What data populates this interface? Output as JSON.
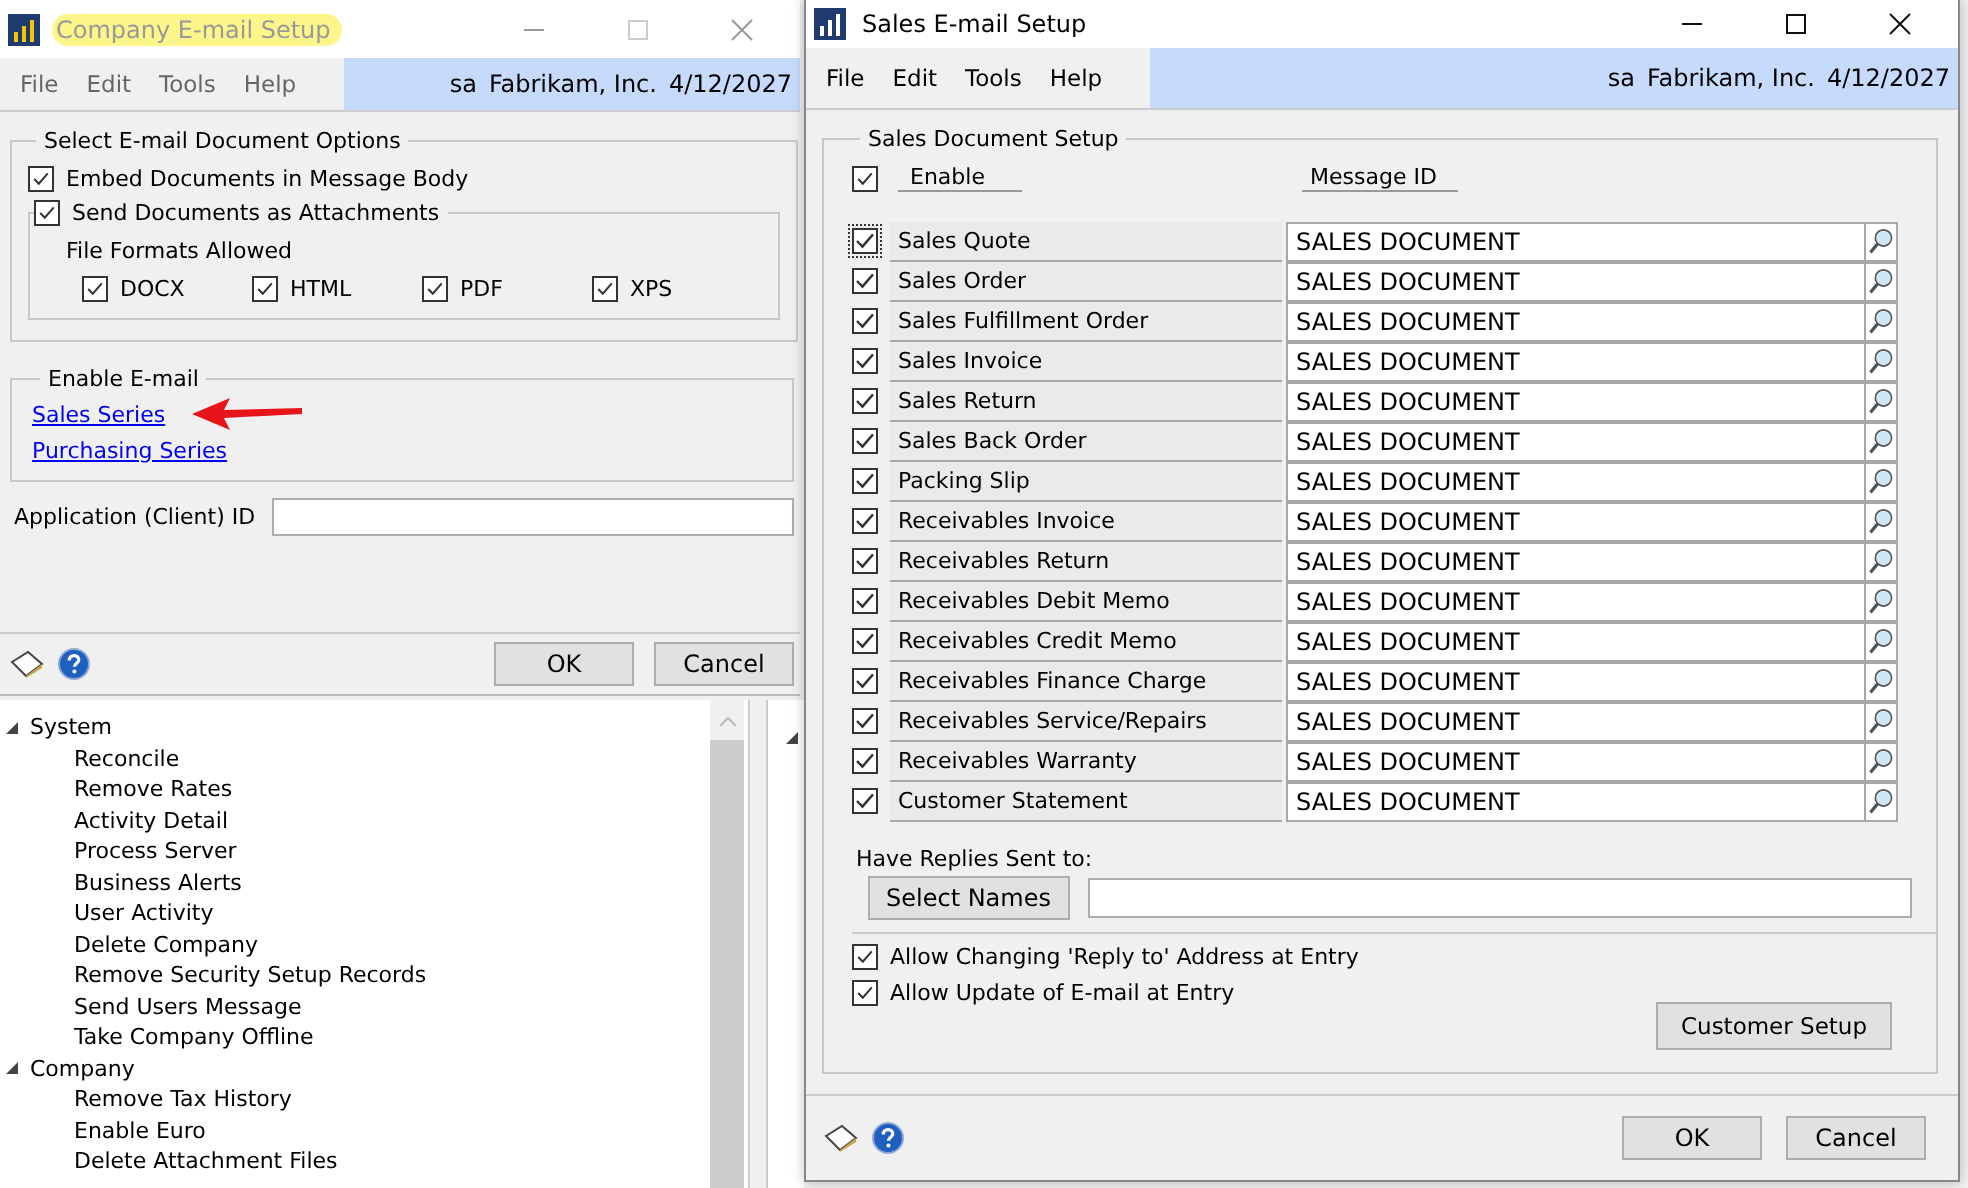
{
  "company_window": {
    "title": "Company E-mail Setup",
    "title_highlighted": true,
    "active": false,
    "menu": [
      "File",
      "Edit",
      "Tools",
      "Help"
    ],
    "status": {
      "user": "sa",
      "company": "Fabrikam, Inc.",
      "date": "4/12/2027"
    },
    "document_options": {
      "legend": "Select E-mail Document Options",
      "embed": {
        "label": "Embed Documents in Message Body",
        "checked": true
      },
      "attach": {
        "label": "Send Documents as Attachments",
        "checked": true
      },
      "formats_label": "File Formats Allowed",
      "formats": [
        {
          "label": "DOCX",
          "checked": true
        },
        {
          "label": "HTML",
          "checked": true
        },
        {
          "label": "PDF",
          "checked": true
        },
        {
          "label": "XPS",
          "checked": true
        }
      ]
    },
    "enable_email": {
      "legend": "Enable E-mail",
      "links": [
        "Sales Series",
        "Purchasing Series"
      ]
    },
    "client_id": {
      "label": "Application (Client) ID"
    },
    "buttons": [
      "OK",
      "Cancel"
    ]
  },
  "navigation_tree": [
    {
      "label": "System",
      "expanded": true,
      "children": [
        {
          "label": "Reconcile"
        },
        {
          "label": "Remove Rates"
        },
        {
          "label": "Activity Detail"
        },
        {
          "label": "Process Server"
        },
        {
          "label": "Business Alerts"
        },
        {
          "label": "User Activity"
        },
        {
          "label": "Delete Company"
        },
        {
          "label": "Remove Security Setup Records"
        },
        {
          "label": "Send Users Message"
        },
        {
          "label": "Take Company Offline"
        }
      ]
    },
    {
      "label": "Company",
      "expanded": true,
      "children": [
        {
          "label": "Remove Tax History"
        },
        {
          "label": "Enable Euro"
        },
        {
          "label": "Delete Attachment Files"
        }
      ]
    }
  ],
  "sales_window": {
    "title": "Sales E-mail Setup",
    "active": true,
    "menu": [
      "File",
      "Edit",
      "Tools",
      "Help"
    ],
    "status": {
      "user": "sa",
      "company": "Fabrikam, Inc.",
      "date": "4/12/2027"
    },
    "legend": "Sales Document Setup",
    "enable_all": {
      "label": "Enable",
      "checked": true
    },
    "message_id_header": "Message ID",
    "rows": [
      {
        "label": "Sales Quote",
        "checked": true,
        "focused": true,
        "message_id": "SALES DOCUMENT"
      },
      {
        "label": "Sales Order",
        "checked": true,
        "focused": false,
        "message_id": "SALES DOCUMENT"
      },
      {
        "label": "Sales Fulfillment Order",
        "checked": true,
        "focused": false,
        "message_id": "SALES DOCUMENT"
      },
      {
        "label": "Sales Invoice",
        "checked": true,
        "focused": false,
        "message_id": "SALES DOCUMENT"
      },
      {
        "label": "Sales Return",
        "checked": true,
        "focused": false,
        "message_id": "SALES DOCUMENT"
      },
      {
        "label": "Sales Back Order",
        "checked": true,
        "focused": false,
        "message_id": "SALES DOCUMENT"
      },
      {
        "label": "Packing Slip",
        "checked": true,
        "focused": false,
        "message_id": "SALES DOCUMENT"
      },
      {
        "label": "Receivables Invoice",
        "checked": true,
        "focused": false,
        "message_id": "SALES DOCUMENT"
      },
      {
        "label": "Receivables Return",
        "checked": true,
        "focused": false,
        "message_id": "SALES DOCUMENT"
      },
      {
        "label": "Receivables Debit Memo",
        "checked": true,
        "focused": false,
        "message_id": "SALES DOCUMENT"
      },
      {
        "label": "Receivables Credit Memo",
        "checked": true,
        "focused": false,
        "message_id": "SALES DOCUMENT"
      },
      {
        "label": "Receivables Finance Charge",
        "checked": true,
        "focused": false,
        "message_id": "SALES DOCUMENT"
      },
      {
        "label": "Receivables Service/Repairs",
        "checked": true,
        "focused": false,
        "message_id": "SALES DOCUMENT"
      },
      {
        "label": "Receivables Warranty",
        "checked": true,
        "focused": false,
        "message_id": "SALES DOCUMENT"
      },
      {
        "label": "Customer Statement",
        "checked": true,
        "focused": false,
        "message_id": "SALES DOCUMENT"
      }
    ],
    "replies_label": "Have Replies Sent to:",
    "select_names_button": "Select Names",
    "options": [
      {
        "label": "Allow Changing 'Reply to' Address at Entry",
        "checked": true
      },
      {
        "label": "Allow Update of E-mail at Entry",
        "checked": true
      }
    ],
    "customer_setup_button": "Customer Setup",
    "buttons": [
      "OK",
      "Cancel"
    ]
  }
}
